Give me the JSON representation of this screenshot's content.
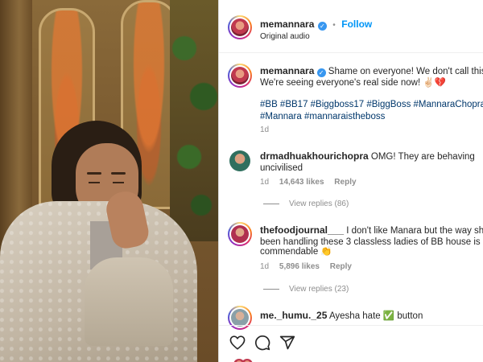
{
  "post": {
    "author": "memannara",
    "follow_label": "Follow",
    "audio": "Original audio",
    "caption_line1": "Shame on everyone! We don't call this a",
    "caption_line2": "We're seeing everyone's real side now! ✌🏻💔",
    "hashtags_line1": "#BB #BB17 #Biggboss17 #BiggBoss #MannaraChopra",
    "hashtags_line2": "#Mannara #mannaraistheboss",
    "time": "1d"
  },
  "comments": [
    {
      "user": "drmadhuakhourichopra",
      "text_line1": "OMG! They are behaving",
      "text_line2": "uncivilised",
      "time": "1d",
      "likes": "14,643 likes",
      "reply_label": "Reply",
      "view_replies": "View replies (86)"
    },
    {
      "user": "thefoodjournal___",
      "text_line1": "I don't like Manara but the way she h",
      "text_line2": "been handling these 3 classless ladies of BB house is",
      "text_line3": "commendable 👏",
      "time": "1d",
      "likes": "5,896 likes",
      "reply_label": "Reply",
      "view_replies": "View replies (23)"
    },
    {
      "user": "me._humu._25",
      "text_line1": "Ayesha hate ✅ button"
    }
  ],
  "actions": {
    "like_icon": "heart-icon",
    "comment_icon": "comment-icon",
    "share_icon": "share-icon"
  },
  "colors": {
    "link": "#0095f6",
    "hashtag": "#00376b",
    "verified": "#3897f0",
    "muted": "#8e8e8e"
  }
}
